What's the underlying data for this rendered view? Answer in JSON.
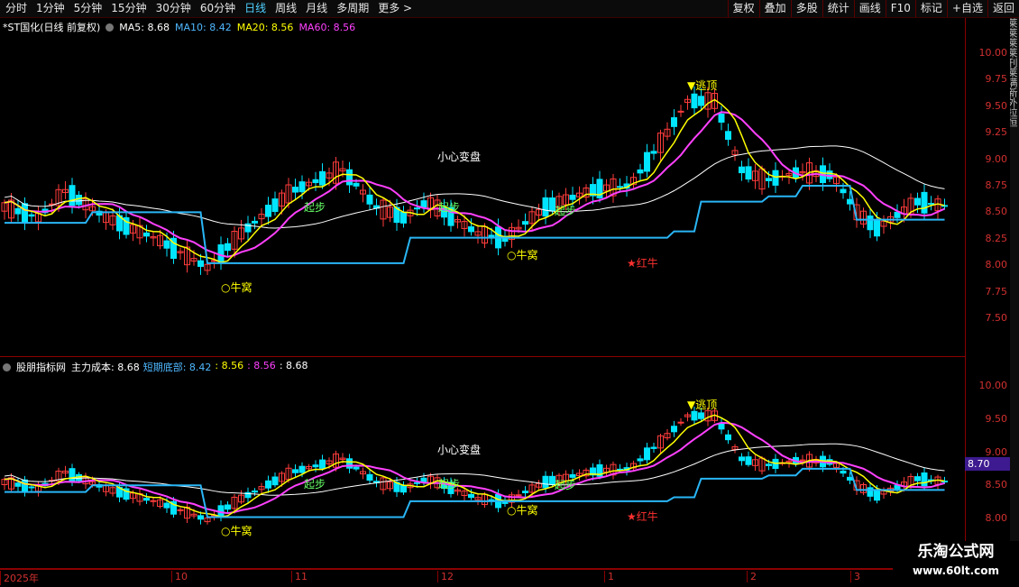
{
  "toolbar": {
    "periods": [
      "分时",
      "1分钟",
      "5分钟",
      "15分钟",
      "30分钟",
      "60分钟",
      "日线",
      "周线",
      "月线",
      "多周期",
      "更多 >"
    ],
    "active_period": "日线",
    "tools": [
      "复权",
      "叠加",
      "多股",
      "统计",
      "画线",
      "F10",
      "标记",
      "+自选",
      "返回"
    ]
  },
  "main_pane": {
    "title": "*ST国化(日线 前复权)",
    "ma": [
      {
        "label": "MA5: 8.68",
        "color": "#ffffff"
      },
      {
        "label": "MA10: 8.42",
        "color": "#4fb8ff"
      },
      {
        "label": "MA20: 8.56",
        "color": "#ffff00"
      },
      {
        "label": "MA60: 8.56",
        "color": "#ff40ff"
      }
    ],
    "y_ticks": [
      "10.00",
      "9.75",
      "9.50",
      "9.25",
      "9.00",
      "8.75",
      "8.50",
      "8.25",
      "8.00",
      "7.75",
      "7.50"
    ],
    "annotations": {
      "escape": "▼逃顶",
      "careful": "小心变盘",
      "nest": "○牛窝",
      "red_bull": "★红牛",
      "start": "起步"
    }
  },
  "sub_pane": {
    "title": "股朋指标网",
    "values": [
      {
        "label": "主力成本: 8.68",
        "color": "#ffffff"
      },
      {
        "label": "短期底部: 8.42",
        "color": "#4fb8ff"
      },
      {
        "label": ": 8.56",
        "color": "#ffff00"
      },
      {
        "label": ": 8.56",
        "color": "#ff40ff"
      },
      {
        "label": ": 8.68",
        "color": "#ffffff"
      }
    ],
    "y_ticks": [
      "10.00",
      "9.50",
      "9.00",
      "8.50",
      "8.00"
    ],
    "cursor_value": "8.70",
    "annotations": {
      "escape": "▼逃顶",
      "careful": "小心变盘",
      "nest": "○牛窝",
      "red_bull": "★红牛",
      "start": "起步"
    }
  },
  "date_axis": [
    "2025年",
    "10",
    "11",
    "12",
    "1",
    "2",
    "3"
  ],
  "right_strip": "莱莱莱莱刊莱满新外拉恒",
  "watermark": {
    "line1": "乐淘公式网",
    "line2": "www.60lt.com"
  },
  "colors": {
    "up": "#ff3c3c",
    "down": "#00e5ff",
    "ma5": "#ffffff",
    "ma10": "#29b6f6",
    "ma20": "#ffff00",
    "ma60": "#ff40ff",
    "grid": "#8b0000"
  }
}
